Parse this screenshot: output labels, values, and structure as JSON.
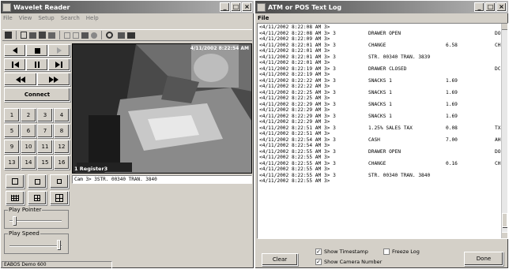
{
  "wavelet": {
    "title": "Wavelet Reader",
    "menu": [
      "File",
      "View",
      "Setup",
      "Search",
      "Help"
    ],
    "connect_label": "Connect",
    "camera_numbers": [
      "1",
      "2",
      "3",
      "4",
      "5",
      "6",
      "7",
      "8",
      "9",
      "10",
      "11",
      "12",
      "13",
      "14",
      "15",
      "16"
    ],
    "play_pointer_label": "Play Pointer",
    "play_speed_label": "Play Speed",
    "video_timestamp": "4/11/2002 8:22:54 AM",
    "video_caption": "1 Register3",
    "overlay_text": "Cam 3> 3STR. 00340 TRAN. 3840",
    "status_text": "EABOS Demo 600"
  },
  "pos_log": {
    "title": "ATM or POS Text Log",
    "menu": [
      "File"
    ],
    "lines": [
      {
        "ts": "<4/11/2002 8:22:08 AM 3>",
        "txt": "",
        "amt": "",
        "tag": ""
      },
      {
        "ts": "<4/11/2002 8:22:08 AM 3> 3",
        "txt": "DRAWER OPEN",
        "amt": "",
        "tag": "DO"
      },
      {
        "ts": "<4/11/2002 8:22:09 AM 3>",
        "txt": "",
        "amt": "",
        "tag": ""
      },
      {
        "ts": "<4/11/2002 8:22:01 AM 3> 3",
        "txt": "CHANGE",
        "amt": "6.58",
        "tag": "CH"
      },
      {
        "ts": "<4/11/2002 8:22:01 AM 3>",
        "txt": "",
        "amt": "",
        "tag": ""
      },
      {
        "ts": "<4/11/2002 8:22:01 AM 3> 3",
        "txt": "STR. 00340 TRAN. 3839",
        "amt": "",
        "tag": ""
      },
      {
        "ts": "<4/11/2002 8:22:01 AM 3>",
        "txt": "",
        "amt": "",
        "tag": ""
      },
      {
        "ts": "<4/11/2002 8:22:19 AM 3> 3",
        "txt": "DRAWER CLOSED",
        "amt": "",
        "tag": "DC"
      },
      {
        "ts": "<4/11/2002 8:22:19 AM 3>",
        "txt": "",
        "amt": "",
        "tag": ""
      },
      {
        "ts": "<4/11/2002 8:22:22 AM 3> 3",
        "txt": "SNACKS 1",
        "amt": "1.69",
        "tag": ""
      },
      {
        "ts": "<4/11/2002 8:22:22 AM 3>",
        "txt": "",
        "amt": "",
        "tag": ""
      },
      {
        "ts": "<4/11/2002 8:22:25 AM 3> 3",
        "txt": "SNACKS 1",
        "amt": "1.69",
        "tag": ""
      },
      {
        "ts": "<4/11/2002 8:22:25 AM 3>",
        "txt": "",
        "amt": "",
        "tag": ""
      },
      {
        "ts": "<4/11/2002 8:22:29 AM 3> 3",
        "txt": "SNACKS 1",
        "amt": "1.69",
        "tag": ""
      },
      {
        "ts": "<4/11/2002 8:22:29 AM 3>",
        "txt": "",
        "amt": "",
        "tag": ""
      },
      {
        "ts": "<4/11/2002 8:22:29 AM 3> 3",
        "txt": "SNACKS 1",
        "amt": "1.69",
        "tag": ""
      },
      {
        "ts": "<4/11/2002 8:22:29 AM 3>",
        "txt": "",
        "amt": "",
        "tag": ""
      },
      {
        "ts": "<4/11/2002 8:22:51 AM 3> 3",
        "txt": "1.25% SALES TAX",
        "amt": "0.08",
        "tag": "TX"
      },
      {
        "ts": "<4/11/2002 8:22:51 AM 3>",
        "txt": "",
        "amt": "",
        "tag": ""
      },
      {
        "ts": "<4/11/2002 8:22:54 AM 3> 3",
        "txt": "CASH",
        "amt": "7.00",
        "tag": "AH"
      },
      {
        "ts": "<4/11/2002 8:22:54 AM 3>",
        "txt": "",
        "amt": "",
        "tag": ""
      },
      {
        "ts": "<4/11/2002 8:22:55 AM 3> 3",
        "txt": "DRAWER OPEN",
        "amt": "",
        "tag": "DO"
      },
      {
        "ts": "<4/11/2002 8:22:55 AM 3>",
        "txt": "",
        "amt": "",
        "tag": ""
      },
      {
        "ts": "<4/11/2002 8:22:55 AM 3> 3",
        "txt": "CHANGE",
        "amt": "0.16",
        "tag": "CH"
      },
      {
        "ts": "<4/11/2002 8:22:55 AM 3>",
        "txt": "",
        "amt": "",
        "tag": ""
      },
      {
        "ts": "<4/11/2002 8:22:55 AM 3> 3",
        "txt": "STR. 00340 TRAN. 3840",
        "amt": "",
        "tag": ""
      },
      {
        "ts": "<4/11/2002 8:22:55 AM 3>",
        "txt": "",
        "amt": "",
        "tag": ""
      }
    ],
    "clear_label": "Clear",
    "done_label": "Done",
    "show_timestamp_label": "Show Timestamp",
    "show_camera_label": "Show Camera Number",
    "freeze_log_label": "Freeze Log",
    "show_timestamp_checked": true,
    "show_camera_checked": true,
    "freeze_log_checked": false
  }
}
